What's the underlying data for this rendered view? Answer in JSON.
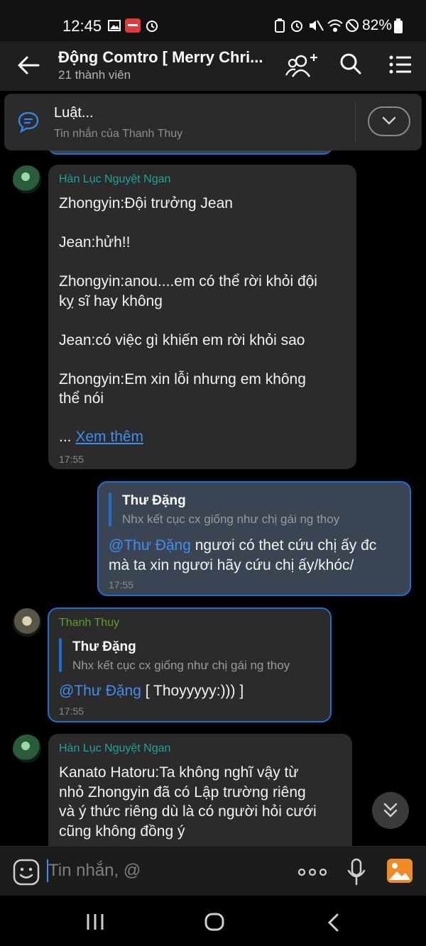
{
  "status_bar": {
    "time": "12:45",
    "battery": "82%"
  },
  "header": {
    "title": "Động Comtro [ Merry Chri...",
    "subtitle": "21 thành viên"
  },
  "pinned": {
    "title": "Luật...",
    "subtitle": "Tin nhắn của Thanh Thuy"
  },
  "messages": [
    {
      "sender": "Hàn Lục Nguyệt Ngan",
      "text": "Zhongyin:Đội trưởng Jean\n\nJean:hửh!!\n\nZhongyin:anou....em có thể rời khỏi đội\nkỵ sĩ hay không\n\nJean:có việc gì khiến em rời khỏi sao\n\nZhongyin:Em xin lỗi nhưng em không\nthể nói",
      "more_prefix": "... ",
      "more_link": "Xem thêm",
      "time": "17:55"
    },
    {
      "quote_name": "Thư Đặng",
      "quote_text": "Nhx kết cục cx giống như chị gái ng thoy",
      "mention": "@Thư Đặng",
      "text": " ngươi có thet cứu chị ấy đc\nmà ta xin ngươi hãy cứu chị ấy/khóc/",
      "time": "17:55"
    },
    {
      "sender": "Thanh Thuy",
      "quote_name": "Thư Đặng",
      "quote_text": "Nhx kết cục cx giống như chị gái ng thoy",
      "mention": "@Thư Đặng",
      "text": " [ Thoyyyyy:))) ]",
      "time": "17:55"
    },
    {
      "sender": "Hàn Lục Nguyệt Ngan",
      "text": "Kanato Hatoru:Ta không nghĩ vậy từ\nnhỏ Zhongyin đã có Lập trường riêng\nvà ý thức riêng dù là có người hỏi cưới\ncũng không đồng ý"
    }
  ],
  "input": {
    "placeholder": "Tin nhắn, @"
  },
  "colors": {
    "accent": "#1f6fd1",
    "sender_teal": "#1fa39a",
    "sender_green": "#5aa02c",
    "link": "#3f8ef0"
  },
  "icons": [
    "back-arrow-icon",
    "add-member-icon",
    "search-icon",
    "menu-icon",
    "chat-bubble-icon",
    "chevron-down-icon",
    "double-chevron-down-icon",
    "emoji-icon",
    "more-icon",
    "mic-icon",
    "image-icon",
    "recents-nav-icon",
    "home-nav-icon",
    "back-nav-icon"
  ]
}
